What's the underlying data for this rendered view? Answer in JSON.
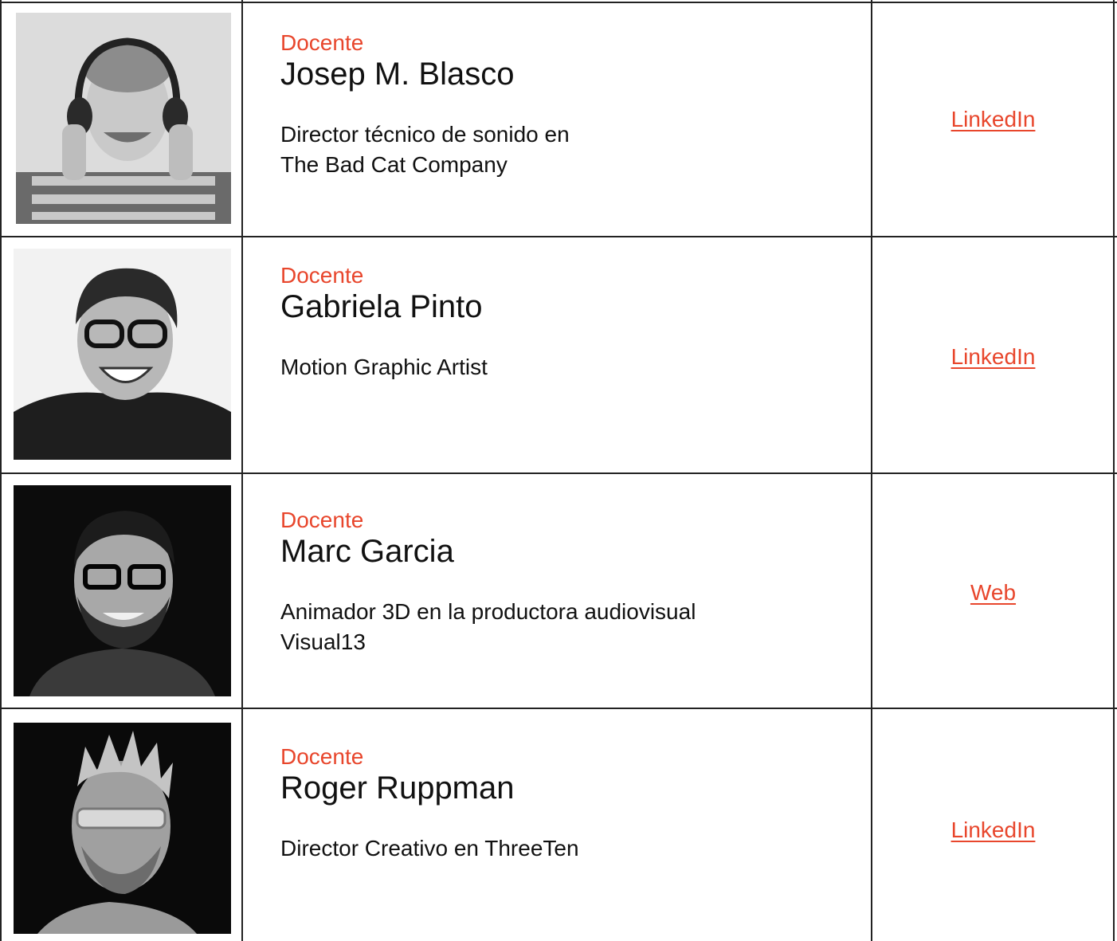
{
  "colors": {
    "accent": "#e8462c",
    "border": "#222222",
    "text": "#111111"
  },
  "teachers": [
    {
      "role": "Docente",
      "name": "Josep M. Blasco",
      "description": "Director técnico de sonido en\nThe Bad Cat Company",
      "link_label": "LinkedIn",
      "photo": "portrait-headphones"
    },
    {
      "role": "Docente",
      "name": "Gabriela Pinto",
      "description": "Motion Graphic Artist",
      "link_label": "LinkedIn",
      "photo": "portrait-glasses-smiling"
    },
    {
      "role": "Docente",
      "name": "Marc Garcia",
      "description": "Animador 3D en la productora audiovisual\nVisual13",
      "link_label": "Web",
      "photo": "portrait-beard-glasses"
    },
    {
      "role": "Docente",
      "name": "Roger Ruppman",
      "description": "Director Creativo en ThreeTen",
      "link_label": "LinkedIn",
      "photo": "portrait-sunglasses-profile"
    }
  ]
}
